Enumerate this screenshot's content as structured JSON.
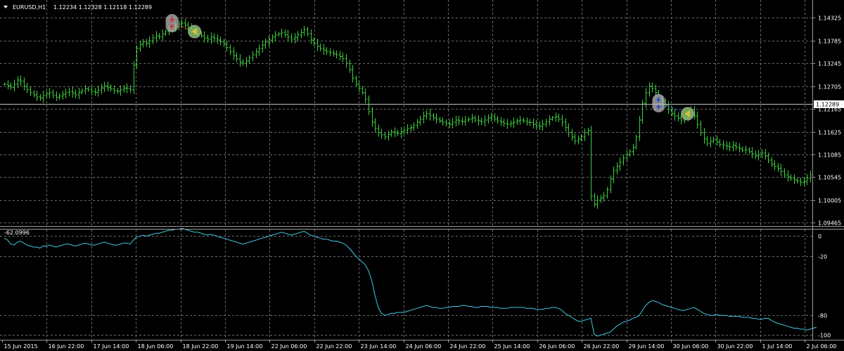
{
  "header": {
    "dropdown_icon": "triangle-down-icon",
    "symbol": "EURUSD,H1",
    "ohlc": "1.12234 1.12328 1.12118 1.12289"
  },
  "price_axis": {
    "labels": [
      "1.14325",
      "1.13785",
      "1.13245",
      "1.12705",
      "1.12165",
      "1.11625",
      "1.11085",
      "1.10545",
      "1.10005",
      "1.09465"
    ],
    "current_price": "1.12289",
    "current_price_color": "#c0c0c0"
  },
  "indicator": {
    "value_label": "-62.0996",
    "axis_labels": [
      "0",
      "-20",
      "-80",
      "-100"
    ],
    "line_color": "#40c8e0"
  },
  "time_axis": {
    "labels": [
      "15 Jun 2015",
      "16 Jun 22:00",
      "17 Jun 14:00",
      "18 Jun 06:00",
      "18 Jun 22:00",
      "19 Jun 14:00",
      "22 Jun 06:00",
      "22 Jun 22:00",
      "23 Jun 14:00",
      "24 Jun 06:00",
      "24 Jun 22:00",
      "25 Jun 14:00",
      "26 Jun 06:00",
      "26 Jun 22:00",
      "29 Jun 14:00",
      "30 Jun 06:00",
      "30 Jun 22:00",
      "1 Jul 14:00",
      "2 Jul 06:00"
    ]
  },
  "colors": {
    "background": "#000000",
    "bars": "#3ecc3e",
    "grid": "#6a6a6a",
    "axis_text": "#ffffff",
    "sell_marker": "#e02020",
    "buy_marker": "#2040e0",
    "close_marker": "#e0c040",
    "trade_line_sell": "#e02020",
    "trade_line_buy": "#2040e0"
  },
  "chart_data": {
    "type": "line",
    "price_ylim": [
      1.094,
      1.147
    ],
    "indicator_ylim": [
      -104,
      6
    ],
    "price_closes": [
      1.1275,
      1.1272,
      1.1268,
      1.1275,
      1.1285,
      1.1282,
      1.127,
      1.1262,
      1.1255,
      1.125,
      1.1245,
      1.1242,
      1.1248,
      1.1252,
      1.1255,
      1.1249,
      1.1244,
      1.1247,
      1.1251,
      1.1255,
      1.1258,
      1.1254,
      1.125,
      1.1256,
      1.126,
      1.1264,
      1.1262,
      1.1258,
      1.1256,
      1.1261,
      1.1266,
      1.1271,
      1.1268,
      1.1264,
      1.126,
      1.1258,
      1.1262,
      1.1266,
      1.1265,
      1.1262,
      1.132,
      1.136,
      1.137,
      1.1375,
      1.1372,
      1.1378,
      1.1385,
      1.139,
      1.1388,
      1.1395,
      1.14,
      1.1405,
      1.141,
      1.1412,
      1.1418,
      1.142,
      1.1415,
      1.141,
      1.1405,
      1.14,
      1.1395,
      1.139,
      1.1385,
      1.1382,
      1.1387,
      1.1384,
      1.138,
      1.1376,
      1.137,
      1.1362,
      1.1352,
      1.1343,
      1.1335,
      1.1328,
      1.1325,
      1.133,
      1.1338,
      1.1345,
      1.1352,
      1.136,
      1.1368,
      1.1375,
      1.138,
      1.1387,
      1.1392,
      1.1395,
      1.1398,
      1.1393,
      1.1387,
      1.1382,
      1.1386,
      1.1392,
      1.1398,
      1.1405,
      1.1395,
      1.138,
      1.1372,
      1.1365,
      1.136,
      1.1356,
      1.1352,
      1.135,
      1.1347,
      1.1345,
      1.1341,
      1.1336,
      1.1325,
      1.131,
      1.129,
      1.1275,
      1.1265,
      1.1255,
      1.124,
      1.121,
      1.1185,
      1.117,
      1.116,
      1.1155,
      1.115,
      1.1156,
      1.1162,
      1.116,
      1.1158,
      1.1162,
      1.1166,
      1.117,
      1.1172,
      1.1177,
      1.1185,
      1.1192,
      1.12,
      1.1205,
      1.12,
      1.1195,
      1.1192,
      1.1188,
      1.1185,
      1.1182,
      1.118,
      1.1185,
      1.119,
      1.1188,
      1.1186,
      1.119,
      1.1192,
      1.1195,
      1.119,
      1.1188,
      1.1186,
      1.119,
      1.1195,
      1.1198,
      1.1193,
      1.1188,
      1.1185,
      1.1182,
      1.118,
      1.1182,
      1.1185,
      1.1188,
      1.119,
      1.1188,
      1.1185,
      1.1184,
      1.118,
      1.1177,
      1.1175,
      1.118,
      1.1186,
      1.1192,
      1.1196,
      1.1198,
      1.1192,
      1.1185,
      1.1172,
      1.116,
      1.115,
      1.114,
      1.1145,
      1.115,
      1.116,
      1.1165,
      1.101,
      1.099,
      1.1,
      1.1005,
      1.101,
      1.1025,
      1.105,
      1.107,
      1.108,
      1.109,
      1.11,
      1.1108,
      1.1115,
      1.1125,
      1.115,
      1.119,
      1.123,
      1.1255,
      1.127,
      1.1265,
      1.1255,
      1.124,
      1.1235,
      1.1225,
      1.1215,
      1.1205,
      1.12,
      1.1195,
      1.119,
      1.1195,
      1.1205,
      1.1215,
      1.12,
      1.118,
      1.116,
      1.1145,
      1.1135,
      1.114,
      1.1145,
      1.1138,
      1.1132,
      1.113,
      1.1128,
      1.1126,
      1.113,
      1.1126,
      1.1122,
      1.1118,
      1.112,
      1.1115,
      1.111,
      1.1105,
      1.1108,
      1.1112,
      1.1105,
      1.1095,
      1.1085,
      1.108,
      1.1075,
      1.1068,
      1.106,
      1.1055,
      1.1052,
      1.1048,
      1.1045,
      1.1042,
      1.1045,
      1.1052,
      1.106
    ],
    "indicator_values": [
      -2,
      -4,
      -8,
      -9,
      -6,
      -5,
      -7,
      -9,
      -10,
      -11,
      -11,
      -12,
      -10,
      -10,
      -9,
      -10,
      -11,
      -10,
      -9,
      -8,
      -8,
      -9,
      -10,
      -9,
      -8,
      -7,
      -8,
      -9,
      -9,
      -8,
      -7,
      -6,
      -7,
      -8,
      -9,
      -9,
      -8,
      -7,
      -7,
      -8,
      -4,
      -1,
      0,
      1,
      0,
      1,
      2,
      3,
      3,
      4,
      5,
      6,
      6,
      7,
      7,
      8,
      7,
      6,
      5,
      4,
      4,
      3,
      2,
      1,
      2,
      1,
      0,
      -1,
      -2,
      -3,
      -4,
      -5,
      -6,
      -7,
      -8,
      -7,
      -6,
      -5,
      -4,
      -3,
      -2,
      -1,
      0,
      1,
      2,
      3,
      4,
      3,
      2,
      1,
      2,
      3,
      4,
      5,
      3,
      1,
      0,
      -1,
      -2,
      -3,
      -3,
      -4,
      -5,
      -5,
      -6,
      -7,
      -9,
      -12,
      -16,
      -20,
      -23,
      -26,
      -29,
      -35,
      -45,
      -60,
      -72,
      -78,
      -80,
      -79,
      -78,
      -78,
      -77,
      -77,
      -77,
      -76,
      -75,
      -74,
      -73,
      -72,
      -71,
      -70,
      -71,
      -72,
      -72,
      -73,
      -73,
      -72,
      -72,
      -71,
      -71,
      -71,
      -70,
      -70,
      -71,
      -71,
      -72,
      -72,
      -71,
      -71,
      -71,
      -72,
      -72,
      -72,
      -73,
      -73,
      -73,
      -72,
      -72,
      -72,
      -72,
      -72,
      -73,
      -73,
      -73,
      -74,
      -74,
      -74,
      -73,
      -73,
      -72,
      -72,
      -73,
      -75,
      -78,
      -80,
      -82,
      -84,
      -86,
      -86,
      -85,
      -84,
      -83,
      -99,
      -101,
      -100,
      -99,
      -98,
      -97,
      -94,
      -91,
      -89,
      -87,
      -86,
      -85,
      -83,
      -82,
      -80,
      -75,
      -70,
      -67,
      -65,
      -66,
      -67,
      -69,
      -70,
      -71,
      -72,
      -73,
      -74,
      -75,
      -75,
      -74,
      -73,
      -72,
      -74,
      -76,
      -78,
      -79,
      -80,
      -80,
      -79,
      -80,
      -80,
      -80,
      -81,
      -81,
      -81,
      -81,
      -82,
      -82,
      -82,
      -83,
      -83,
      -84,
      -84,
      -83,
      -83,
      -85,
      -87,
      -88,
      -89,
      -90,
      -91,
      -92,
      -93,
      -93,
      -94,
      -94,
      -95,
      -94,
      -93,
      -92
    ],
    "trades": [
      {
        "type": "sell",
        "open_index": 52,
        "close_index": 59
      },
      {
        "type": "buy",
        "open_index": 203,
        "close_index": 212
      }
    ]
  }
}
